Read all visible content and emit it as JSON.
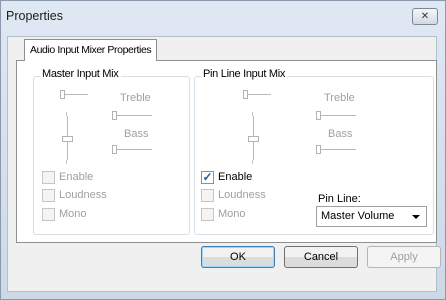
{
  "window": {
    "title": "Properties",
    "close_glyph": "✕"
  },
  "tabs": [
    {
      "label": "Audio Input Mixer Properties",
      "selected": true
    }
  ],
  "master_input_mix": {
    "label": "Master Input Mix",
    "treble_label": "Treble",
    "bass_label": "Bass",
    "enable": {
      "label": "Enable",
      "checked": false
    },
    "loudness": {
      "label": "Loudness",
      "checked": false
    },
    "mono": {
      "label": "Mono",
      "checked": false
    }
  },
  "pin_line_input_mix": {
    "label": "Pin Line Input Mix",
    "treble_label": "Treble",
    "bass_label": "Bass",
    "enable": {
      "label": "Enable",
      "checked": true,
      "check_glyph": "✓"
    },
    "loudness": {
      "label": "Loudness",
      "checked": false
    },
    "mono": {
      "label": "Mono",
      "checked": false
    },
    "pin_line_label": "Pin Line:",
    "pin_line_value": "Master Volume"
  },
  "buttons": {
    "ok": "OK",
    "cancel": "Cancel",
    "apply": "Apply"
  },
  "colors": {
    "accent": "#3c7fb1",
    "disabled_text": "#a0a0a0",
    "check": "#1b5fa8"
  }
}
